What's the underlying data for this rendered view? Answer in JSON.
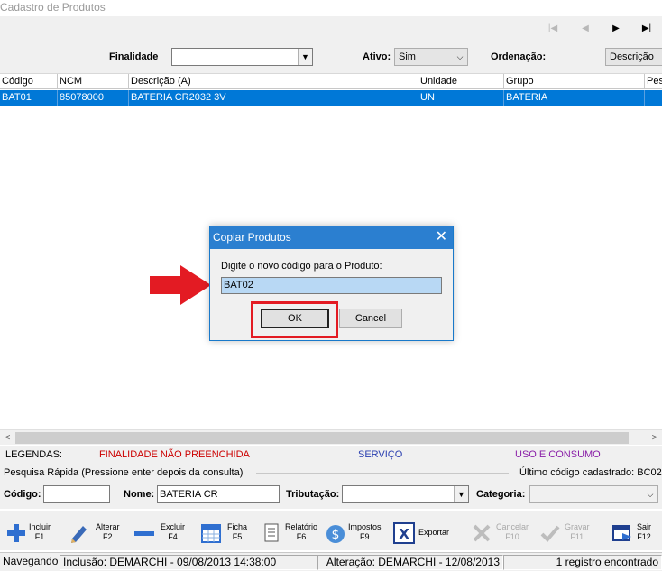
{
  "window": {
    "title": "Cadastro de Produtos"
  },
  "nav": {
    "first": "|◀",
    "prev": "◀",
    "next": "▶",
    "last": "▶|"
  },
  "filters": {
    "finalidade_label": "Finalidade",
    "finalidade_value": "",
    "ativo_label": "Ativo:",
    "ativo_value": "Sim",
    "ordenacao_label": "Ordenação:",
    "ordenacao_value": "Descrição"
  },
  "grid": {
    "columns": [
      "Código",
      "NCM",
      "Descrição (A)",
      "Unidade",
      "Grupo",
      "Pes"
    ],
    "rows": [
      [
        "BAT01",
        "85078000",
        "BATERIA CR2032 3V",
        "UN",
        "BATERIA",
        ""
      ]
    ]
  },
  "legend": {
    "title": "LEGENDAS:",
    "items": [
      {
        "label": "FINALIDADE NÃO PREENCHIDA",
        "color": "#cc0000"
      },
      {
        "label": "SERVIÇO",
        "color": "#2a3fb0"
      },
      {
        "label": "USO E CONSUMO",
        "color": "#8a1fa8"
      }
    ]
  },
  "quick_search": {
    "title": "Pesquisa Rápida (Pressione enter depois da consulta)",
    "last_code_label": "Último código cadastrado: BC02",
    "codigo_label": "Código:",
    "codigo_value": "",
    "nome_label": "Nome:",
    "nome_value": "BATERIA CR",
    "tributacao_label": "Tributação:",
    "tributacao_value": "",
    "categoria_label": "Categoria:",
    "categoria_value": ""
  },
  "toolbar": [
    {
      "label": "Incluir",
      "key": "F1",
      "icon": "plus-icon",
      "enabled": true
    },
    {
      "label": "Alterar",
      "key": "F2",
      "icon": "pencil-icon",
      "enabled": true
    },
    {
      "label": "Excluir",
      "key": "F4",
      "icon": "minus-icon",
      "enabled": true
    },
    {
      "label": "Ficha",
      "key": "F5",
      "icon": "calendar-icon",
      "enabled": true
    },
    {
      "label": "Relatório",
      "key": "F6",
      "icon": "report-icon",
      "enabled": true
    },
    {
      "label": "Impostos",
      "key": "F9",
      "icon": "dollar-icon",
      "enabled": true
    },
    {
      "label": "Exportar",
      "key": "",
      "icon": "excel-icon",
      "enabled": true
    },
    {
      "label": "Cancelar",
      "key": "F10",
      "icon": "cancel-icon",
      "enabled": false
    },
    {
      "label": "Gravar",
      "key": "F11",
      "icon": "check-icon",
      "enabled": false
    },
    {
      "label": "Sair",
      "key": "F12",
      "icon": "exit-icon",
      "enabled": true
    }
  ],
  "status": {
    "mode": "Navegando",
    "inclusao": "Inclusão: DEMARCHI - 09/08/2013 14:38:00",
    "alteracao": "Alteração: DEMARCHI - 12/08/2013",
    "count": "1 registro encontrado"
  },
  "dialog": {
    "title": "Copiar Produtos",
    "prompt": "Digite o novo código para o Produto:",
    "input_value": "BAT02",
    "ok_label": "OK",
    "cancel_label": "Cancel"
  },
  "colors": {
    "accent": "#0078d7",
    "highlight": "#e31b23"
  }
}
